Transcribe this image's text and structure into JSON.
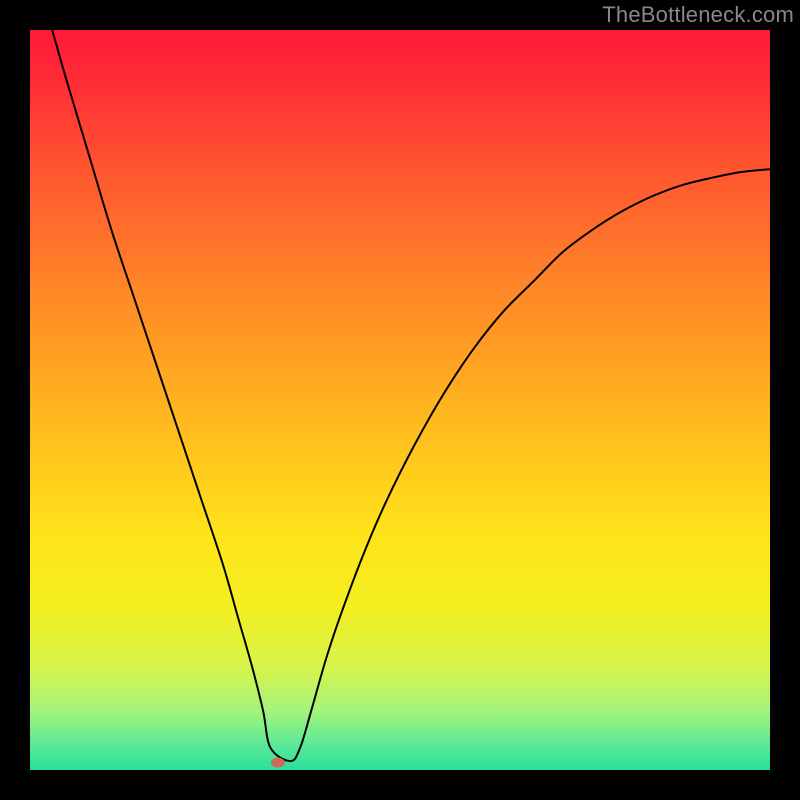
{
  "watermark": "TheBottleneck.com",
  "chart_data": {
    "type": "line",
    "title": "",
    "xlabel": "",
    "ylabel": "",
    "xlim": [
      0,
      100
    ],
    "ylim": [
      0,
      100
    ],
    "background_gradient": {
      "stops": [
        {
          "offset": 0.0,
          "color": "#ff1a38"
        },
        {
          "offset": 0.08,
          "color": "#ff2f36"
        },
        {
          "offset": 0.18,
          "color": "#ff5330"
        },
        {
          "offset": 0.3,
          "color": "#ff782a"
        },
        {
          "offset": 0.42,
          "color": "#ff9a24"
        },
        {
          "offset": 0.55,
          "color": "#ffbf1e"
        },
        {
          "offset": 0.68,
          "color": "#ffe31a"
        },
        {
          "offset": 0.78,
          "color": "#f3ef20"
        },
        {
          "offset": 0.86,
          "color": "#d8f44a"
        },
        {
          "offset": 0.92,
          "color": "#a4f47a"
        },
        {
          "offset": 0.97,
          "color": "#55e89a"
        },
        {
          "offset": 1.0,
          "color": "#2adf98"
        }
      ]
    },
    "marker": {
      "x": 33.5,
      "y": 1.0,
      "color": "#c96a5c"
    },
    "series": [
      {
        "name": "bottleneck-curve",
        "color": "#000000",
        "x": [
          3.0,
          5,
          8,
          11,
          14,
          17,
          20,
          23,
          26,
          28,
          30,
          31.5,
          32.5,
          35.2,
          36.5,
          38,
          40,
          42,
          45,
          48,
          52,
          56,
          60,
          64,
          68,
          72,
          76,
          80,
          84,
          88,
          92,
          96,
          100
        ],
        "values": [
          100,
          93,
          83,
          73,
          64,
          55,
          46,
          37,
          28,
          21,
          14,
          8,
          3,
          1.2,
          3,
          8,
          15,
          21,
          29,
          36,
          44,
          51,
          57,
          62,
          66,
          70,
          73,
          75.5,
          77.5,
          79,
          80,
          80.8,
          81.2
        ]
      }
    ]
  }
}
